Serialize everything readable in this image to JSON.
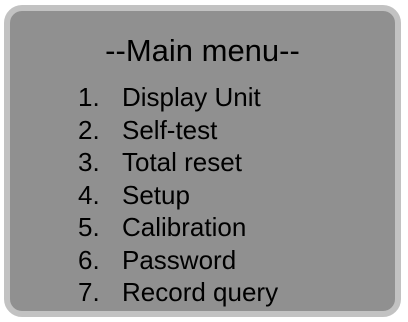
{
  "screen": {
    "title": "--Main menu--",
    "background_color": "#909090",
    "border_color": "#c2c2c2"
  },
  "menu": {
    "items": [
      {
        "number": "1.",
        "label": "Display Unit"
      },
      {
        "number": "2.",
        "label": "Self-test"
      },
      {
        "number": "3.",
        "label": "Total reset"
      },
      {
        "number": "4.",
        "label": "Setup"
      },
      {
        "number": "5.",
        "label": "Calibration"
      },
      {
        "number": "6.",
        "label": "Password"
      },
      {
        "number": "7.",
        "label": "Record query"
      }
    ]
  }
}
